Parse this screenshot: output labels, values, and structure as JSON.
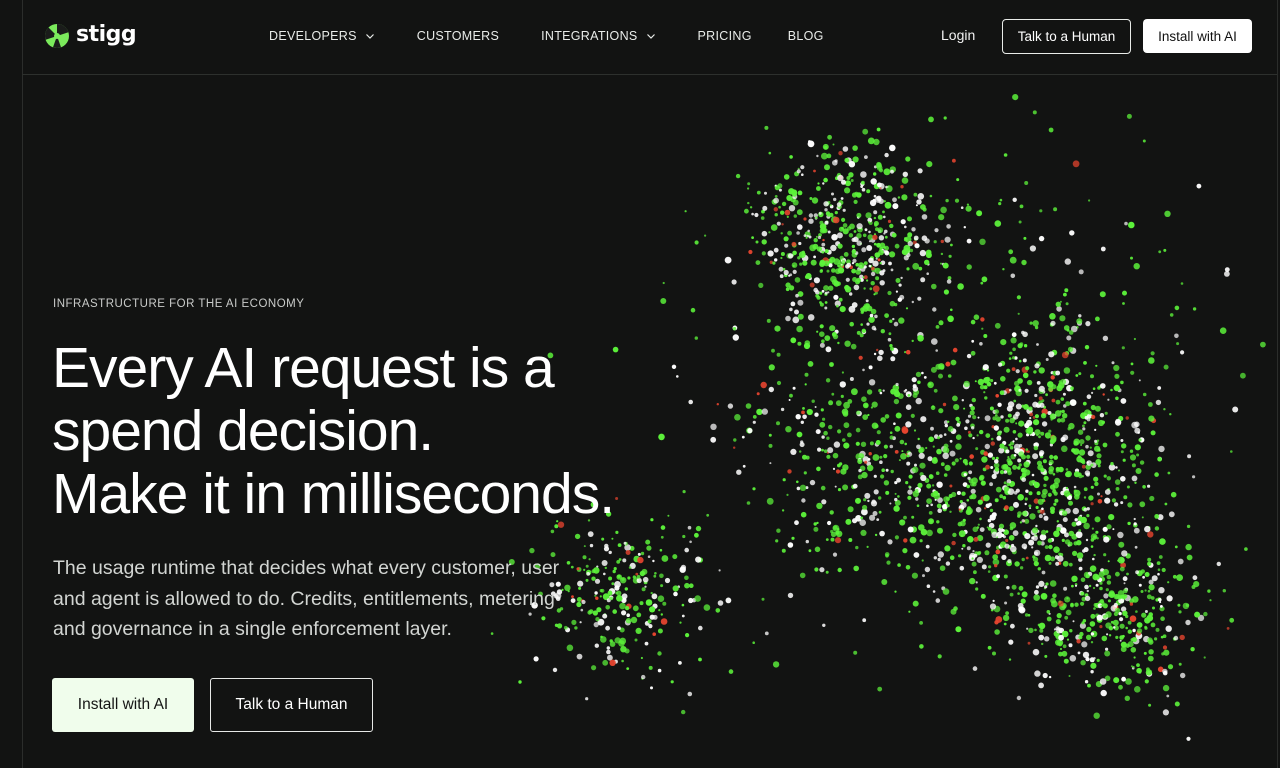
{
  "header": {
    "logo_text": "stigg",
    "nav": [
      {
        "label": "DEVELOPERS",
        "dropdown": true
      },
      {
        "label": "CUSTOMERS",
        "dropdown": false
      },
      {
        "label": "INTEGRATIONS",
        "dropdown": true
      },
      {
        "label": "PRICING",
        "dropdown": false
      },
      {
        "label": "BLOG",
        "dropdown": false
      }
    ],
    "login_label": "Login",
    "talk_label": "Talk to a Human",
    "install_label": "Install with AI"
  },
  "hero": {
    "eyebrow": "INFRASTRUCTURE FOR THE AI ECONOMY",
    "headline_lines": [
      "Every AI request is a",
      "spend decision.",
      "Make it in milliseconds."
    ],
    "subtext_lines": [
      "The usage runtime that decides what every customer, user",
      "and agent is allowed to do. Credits, entitlements, metering",
      "and governance in a single enforcement layer."
    ],
    "primary_cta": "Install with AI",
    "secondary_cta": "Talk to a Human"
  },
  "colors": {
    "background": "#121312",
    "accent_green": "#5cf23a",
    "particle_white": "#ffffff",
    "particle_red": "#e8452f"
  },
  "icons": {
    "logo": "stigg-logo-mark-icon",
    "dropdown": "chevron-down-icon"
  }
}
